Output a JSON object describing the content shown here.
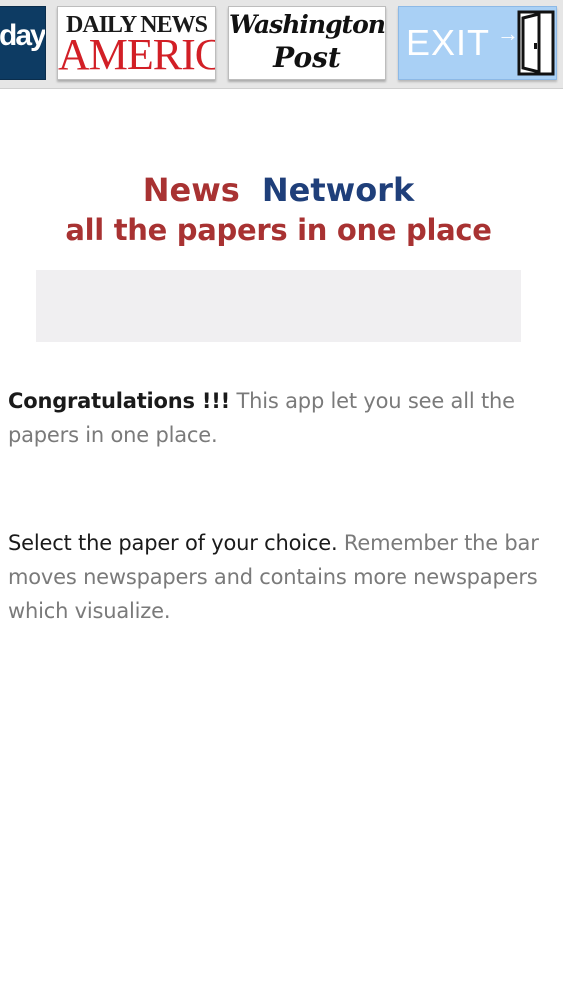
{
  "paper_bar": {
    "items": [
      {
        "label": "day",
        "name": "USA Today"
      },
      {
        "line1": "DAILY NEWS",
        "line2": "AMERICA"
      },
      {
        "line1": "Washington",
        "line2": "Post"
      },
      {
        "label": "EXIT",
        "arrow": "→"
      }
    ]
  },
  "banner": {
    "word1": "News",
    "word2": "Network",
    "tagline": "all the papers in one place"
  },
  "intro": {
    "bold": "Congratulations !!!",
    "rest": " This app let you see all the papers in one place."
  },
  "instructions": {
    "dark": "Select the paper of your choice.",
    "rest": " Remember the bar moves newspapers and contains more newspapers which visualize."
  },
  "colors": {
    "banner_red": "#a83232",
    "banner_blue": "#1f3f7a",
    "exit_bg": "#a9d0f5",
    "daily_news_red": "#d21f26"
  }
}
